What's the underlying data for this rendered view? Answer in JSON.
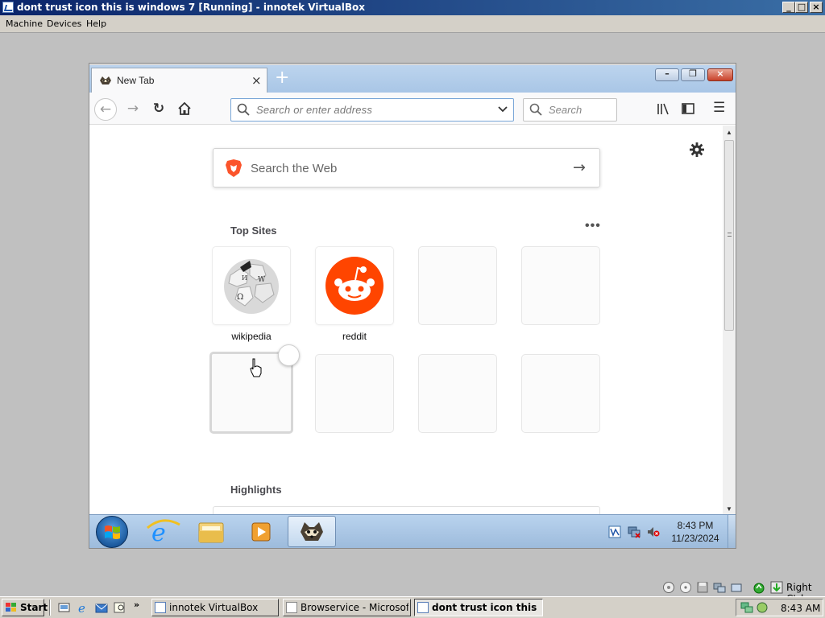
{
  "vbox": {
    "title": "dont trust icon this is windows 7 [Running] - innotek VirtualBox",
    "controls": {
      "minimize": "_",
      "maximize": "□",
      "close": "×"
    },
    "menu": [
      "Machine",
      "Devices",
      "Help"
    ],
    "status": {
      "host_key": "Right Ctrl"
    }
  },
  "firefox": {
    "tab": {
      "title": "New Tab",
      "close": "×"
    },
    "new_tab": "+",
    "window_controls": {
      "minimize": "–",
      "restore": "❐",
      "close": "×"
    },
    "nav": {
      "back": "←",
      "forward": "→",
      "reload": "↻"
    },
    "urlbar": {
      "placeholder": "Search or enter address"
    },
    "searchbar": {
      "placeholder": "Search"
    },
    "menu_glyph": "☰",
    "newtab_page": {
      "web_search_placeholder": "Search the Web",
      "web_search_go": "→",
      "top_sites_title": "Top Sites",
      "top_sites_menu": "•••",
      "top_sites": [
        {
          "label": "wikipedia",
          "icon": "wikipedia-globe-icon"
        },
        {
          "label": "reddit",
          "icon": "reddit-alien-icon"
        },
        {
          "label": "",
          "icon": ""
        },
        {
          "label": "",
          "icon": ""
        },
        {
          "label": "",
          "icon": ""
        },
        {
          "label": "",
          "icon": ""
        },
        {
          "label": "",
          "icon": ""
        },
        {
          "label": "",
          "icon": ""
        }
      ],
      "highlights_title": "Highlights"
    }
  },
  "win7_taskbar": {
    "time": "8:43 PM",
    "date": "11/23/2024",
    "pinned": [
      "ie-icon",
      "explorer-icon",
      "media-player-icon",
      "firefox-icon"
    ]
  },
  "host_taskbar": {
    "start_label": "Start",
    "tasks": [
      {
        "label": "innotek VirtualBox",
        "active": false
      },
      {
        "label": "Browservice - Microsoft Int...",
        "active": false
      },
      {
        "label": "dont trust icon this is ...",
        "active": true
      }
    ],
    "clock": "8:43 AM"
  },
  "colors": {
    "reddit_orange": "#ff4500",
    "brave_orange": "#fb542b",
    "vbox_titlebar": "#0a246a"
  }
}
